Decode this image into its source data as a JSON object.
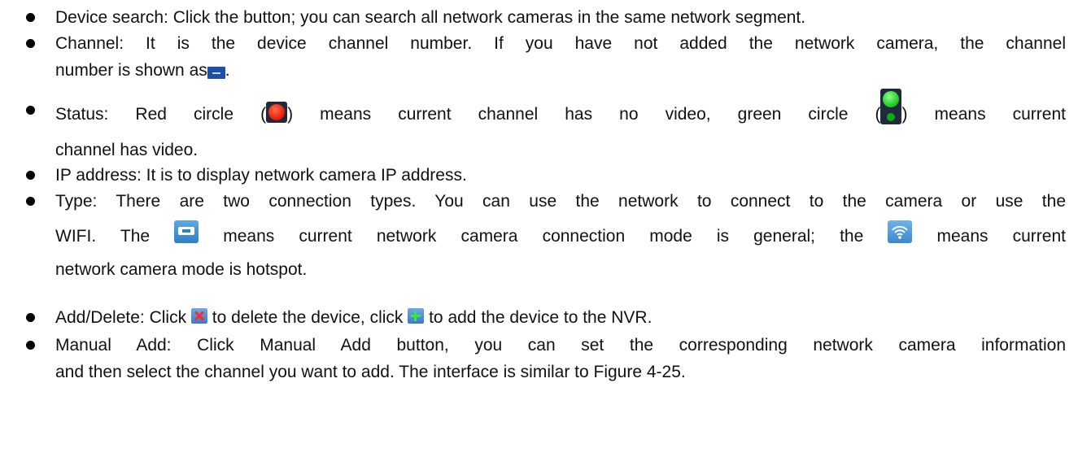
{
  "items": [
    {
      "lines": [
        "Device search: Click the button; you can search all network cameras in the same network segment."
      ]
    },
    {
      "lines": [
        "Channel: It is the device channel number. If you have not added the network camera, the channel",
        "number is shown as",
        "."
      ]
    },
    {
      "lines": [
        "Status: Red circle (",
        ") means current channel has no video, green circle (",
        ") means current",
        "channel has video."
      ]
    },
    {
      "lines": [
        "IP address: It is to display network camera IP address."
      ]
    },
    {
      "lines": [
        "Type: There are two connection types. You can use the network to connect to the camera or use the",
        "WIFI. The",
        "means current network camera connection mode is general; the",
        "means current",
        "network camera mode is hotspot."
      ]
    },
    {
      "lines": [
        "Add/Delete: Click",
        "to delete the device, click",
        "to add the device to the NVR."
      ]
    },
    {
      "lines": [
        "Manual Add: Click Manual Add button, you can set the corresponding network camera information",
        "and then select the channel you want to add. The interface is similar to Figure 4-25."
      ]
    }
  ],
  "icons": {
    "channel": "channel-number-icon",
    "red_circle": "red-circle-icon",
    "green_circle": "green-circle-icon",
    "network": "network-connection-icon",
    "wifi": "wifi-hotspot-icon",
    "delete": "delete-icon",
    "add": "add-icon"
  },
  "colors": {
    "red_status": "#e21b0a",
    "green_status": "#19c41c",
    "icon_blue": "#3c7ac8"
  }
}
